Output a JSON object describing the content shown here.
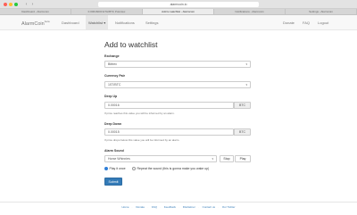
{
  "browser": {
    "url": "alarmcoin.io",
    "nav": {
      "back": "‹",
      "forward": "›"
    },
    "tabs": [
      "Dashboard - Alarmcoin",
      "0.00016000 ETH/BTC Poloniex",
      "Add to watchlist - Alarmcoin",
      "Notifications - Alarmcoin",
      "Settings - Alarmcoin"
    ]
  },
  "navbar": {
    "brand": "AlarmCoin",
    "brand_badge": "beta",
    "links": {
      "dashboard": "Dashboard",
      "watchlist": "Watchlist",
      "notifications": "Notifications",
      "settings": "Settings"
    },
    "watchlist_caret": "▾",
    "right": {
      "donate": "Donate",
      "faq": "FAQ",
      "logout": "Logout"
    }
  },
  "form": {
    "title": "Add to watchlist",
    "exchange": {
      "label": "Exchange",
      "value": "Bittrex"
    },
    "pair": {
      "label": "Currency Pair",
      "value": "1ST/BTC"
    },
    "deep_up": {
      "label": "Deep Up",
      "value": "0.00016",
      "unit": "BTC",
      "help": "If price reaches this value you will be informed by an alarm."
    },
    "deep_down": {
      "label": "Deep Down",
      "value": "0.00015",
      "unit": "BTC",
      "help": "If price drops below this value you will be informed by an alarm."
    },
    "sound": {
      "label": "Alarm Sound",
      "value": "Horse Whinnies",
      "stop": "Stop",
      "play": "Play"
    },
    "radio": {
      "once": "Play it once",
      "repeat": "Repeat the sound (this is gonna make you wake up)",
      "selected": "once"
    },
    "submit": "Submit",
    "caret": "▾"
  },
  "footer": {
    "links": {
      "home": "Home",
      "donate": "Donate",
      "faq": "FAQ",
      "feedback": "Feedback",
      "disclaimer": "Disclaimer",
      "contact": "Contact us",
      "twitter": "Our Twitter"
    },
    "separator": "·"
  },
  "colors": {
    "primary": "#337ab7",
    "navbar_bg": "#f8f8f8"
  }
}
